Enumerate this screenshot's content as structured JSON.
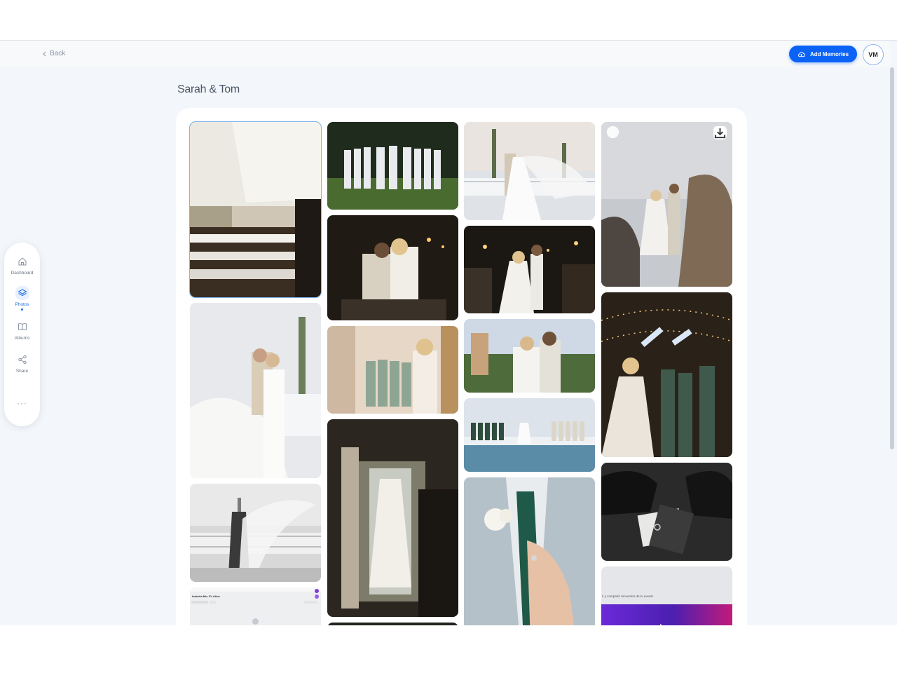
{
  "topbar": {
    "back_label": "Back",
    "add_button_label": "Add Memories",
    "avatar_initials": "VM"
  },
  "page_title": "Sarah & Tom",
  "sidebar": {
    "items": [
      {
        "label": "Dashboard",
        "icon": "home-icon"
      },
      {
        "label": "Photos",
        "icon": "layers-icon"
      },
      {
        "label": "Albums",
        "icon": "book-icon"
      },
      {
        "label": "Share",
        "icon": "share-icon"
      }
    ],
    "more": "···"
  },
  "gallery": {
    "screenshot_a_title": "Isabella Mis XV Años",
    "screenshot_b_text": "ir y compartir recuerdos de tu evento"
  },
  "colors": {
    "accent": "#0b63f6",
    "background": "#f3f6fa",
    "panel": "#ffffff"
  }
}
